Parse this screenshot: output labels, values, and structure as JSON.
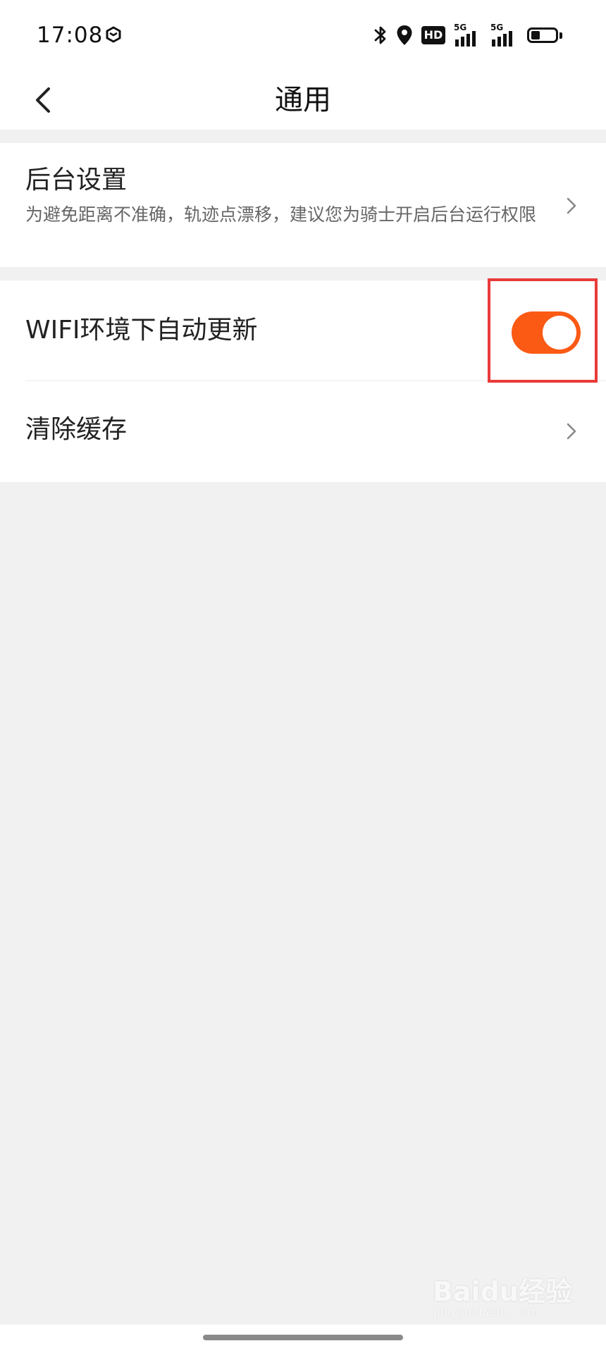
{
  "status_bar": {
    "time": "17:08",
    "hd_label": "HD",
    "signal_1_label": "5G",
    "signal_2_label": "5G"
  },
  "header": {
    "title": "通用"
  },
  "settings": {
    "background": {
      "title": "后台设置",
      "description": "为避免距离不准确，轨迹点漂移，建议您为骑士开启后台运行权限"
    },
    "wifi_update": {
      "title": "WIFI环境下自动更新",
      "enabled": true
    },
    "clear_cache": {
      "title": "清除缓存"
    }
  },
  "watermark": {
    "logo": "Baidu经验",
    "url": "jingyan.baidu.com"
  },
  "colors": {
    "accent": "#fb5a14",
    "highlight": "#e93a3a",
    "background": "#f1f1f1"
  },
  "icons": [
    "bluetooth-icon",
    "location-icon",
    "hd-icon",
    "signal-icon",
    "battery-icon",
    "back-arrow-icon",
    "chevron-right-icon"
  ]
}
